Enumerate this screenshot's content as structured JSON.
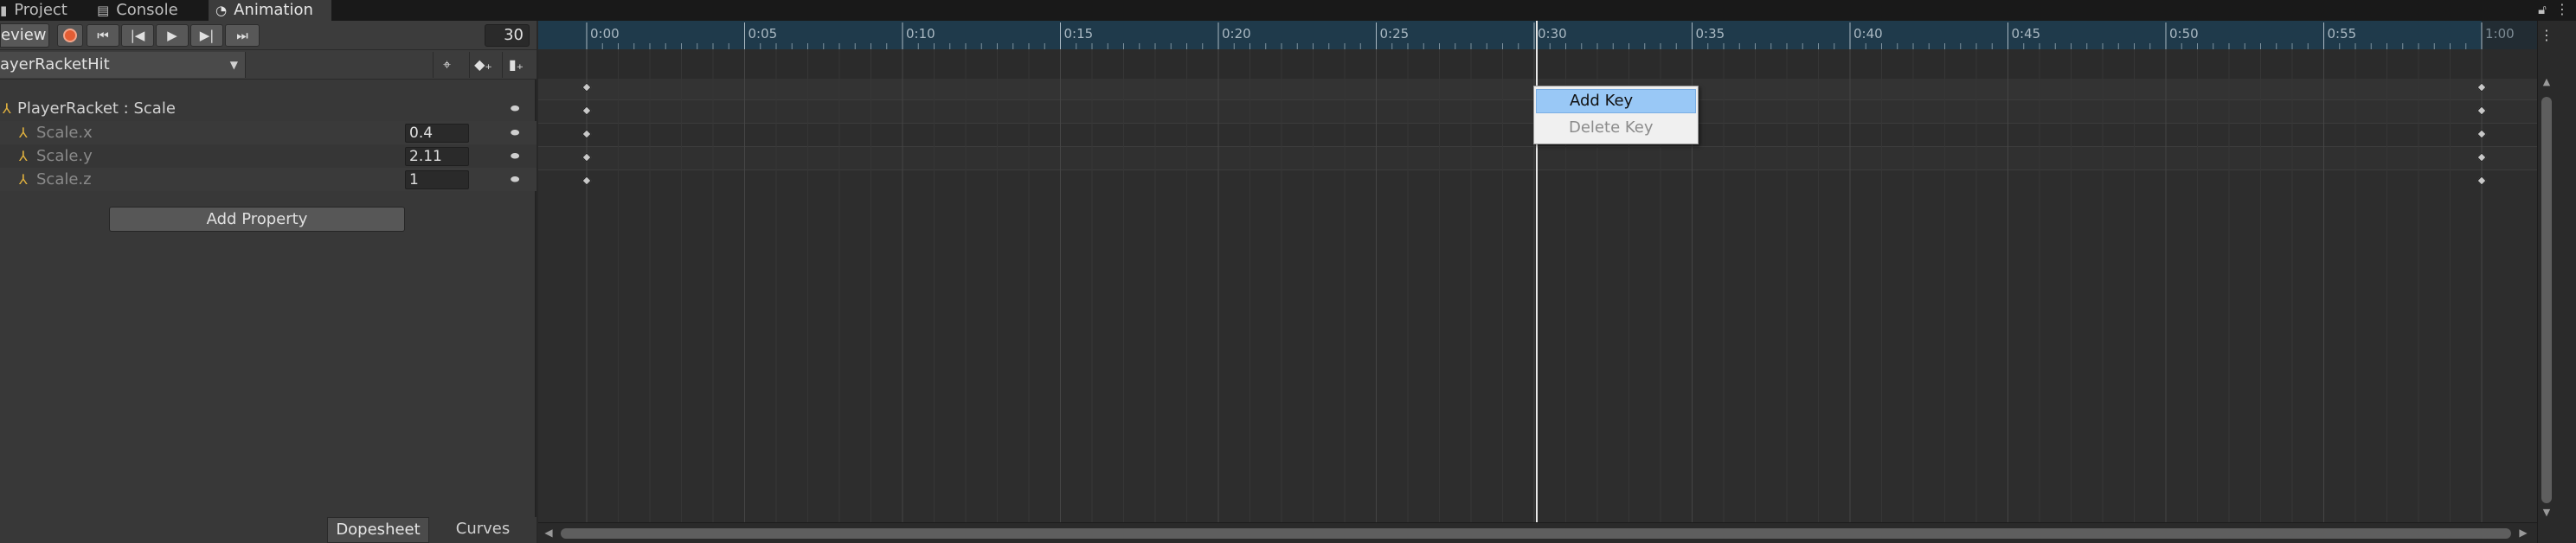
{
  "tabs": [
    {
      "label": "Project",
      "icon": "folder-icon"
    },
    {
      "label": "Console",
      "icon": "console-icon"
    },
    {
      "label": "Animation",
      "icon": "animation-clock-icon"
    }
  ],
  "toolbar": {
    "preview_label": "eview",
    "frame_value": "30",
    "clip_name": "ayerRacketHit"
  },
  "properties": {
    "parent": {
      "label": "PlayerRacket : Scale"
    },
    "items": [
      {
        "label": "Scale.x",
        "value": "0.4"
      },
      {
        "label": "Scale.y",
        "value": "2.11"
      },
      {
        "label": "Scale.z",
        "value": "1"
      }
    ],
    "add_label": "Add Property"
  },
  "bottom_tabs": {
    "dopesheet": "Dopesheet",
    "curves": "Curves"
  },
  "ruler": {
    "labels": [
      "0:00",
      "0:05",
      "0:10",
      "0:15",
      "0:20",
      "0:25",
      "0:30",
      "0:35",
      "0:40",
      "0:45",
      "0:50",
      "0:55",
      "1:00"
    ]
  },
  "playhead_time": "0:30",
  "keyframe_times": [
    "0:00",
    "1:00"
  ],
  "context_menu": {
    "add_key": "Add Key",
    "delete_key": "Delete Key"
  },
  "colors": {
    "ruler": "#1f3a4b",
    "record": "#e35d34",
    "menu_highlight": "#99c8f6",
    "property_icon": "#e2b23f"
  }
}
